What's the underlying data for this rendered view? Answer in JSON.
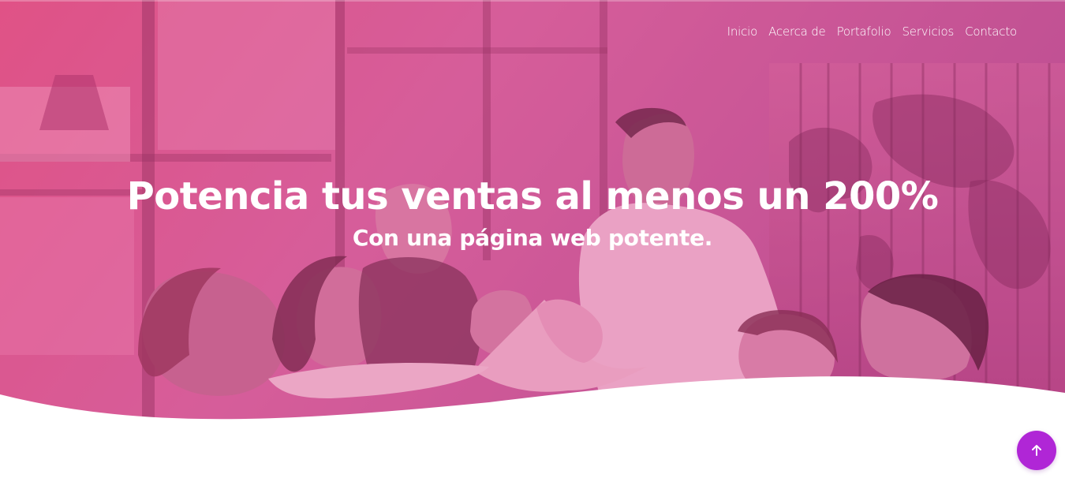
{
  "nav": {
    "items": [
      {
        "label": "Inicio"
      },
      {
        "label": "Acerca de"
      },
      {
        "label": "Portafolio"
      },
      {
        "label": "Servicios"
      },
      {
        "label": "Contacto"
      }
    ]
  },
  "hero": {
    "title": "Potencia tus ventas al menos un 200%",
    "subtitle": "Con una página web potente.",
    "overlay_color": "#d6488f",
    "image_subject": "group-high-five-photo"
  },
  "scroll_top": {
    "icon": "arrow-up-icon",
    "color": "#b026d6"
  },
  "colors": {
    "overlay_top_left": "#e0457f",
    "overlay_right": "#b94a96",
    "accent": "#b026d6",
    "text": "#ffffff"
  }
}
